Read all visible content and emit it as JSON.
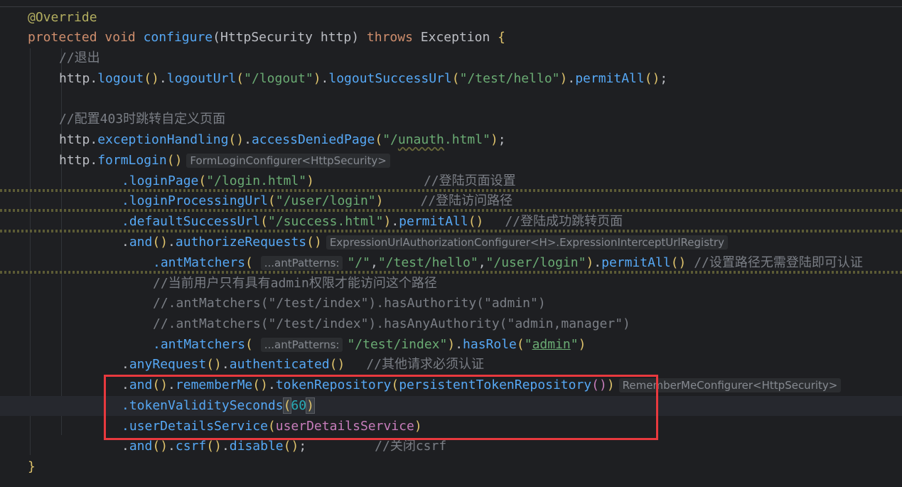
{
  "code_lines": {
    "l1_annotation": "@Override",
    "l2_kw_protected": "protected",
    "l2_kw_void": "void",
    "l2_method": "configure",
    "l2_params": "(HttpSecurity http)",
    "l2_kw_throws": "throws",
    "l2_exception": "Exception",
    "l2_brace": "{",
    "l3_comment": "//退出",
    "l4_http": "http.",
    "l4_logout": "logout",
    "l4_url": "\"/logout\"",
    "l4_success_url": "\"/test/hello\"",
    "l4_logout_url_method": "logoutUrl",
    "l4_logout_success_method": "logoutSuccessUrl",
    "l4_permit": "permitAll",
    "l6_comment": "//配置403时跳转自定义页面",
    "l7_exception": "exceptionHandling",
    "l7_denied": "accessDeniedPage",
    "l7_str_open": "\"/",
    "l7_str_unauth": "unauth",
    "l7_str_close": ".html\"",
    "l8_form": "formLogin",
    "l8_hint": "FormLoginConfigurer<HttpSecurity>",
    "l9_method": ".loginPage",
    "l9_str": "\"/login.html\"",
    "l9_comment": "//登陆页面设置",
    "l10_method": ".loginProcessingUrl",
    "l10_str": "\"/user/login\"",
    "l10_comment": "//登陆访问路径",
    "l11_method": ".defaultSuccessUrl",
    "l11_str": "\"/success.html\"",
    "l11_permit": "permitAll",
    "l11_comment": "//登陆成功跳转页面",
    "l12_and": "and",
    "l12_auth": "authorizeRequests",
    "l12_hint": "ExpressionUrlAuthorizationConfigurer<H>.ExpressionInterceptUrlRegistry",
    "l13_method": ".antMatchers",
    "l13_hint": "...antPatterns:",
    "l13_s1": "\"/\"",
    "l13_s2": "\"/test/hello\"",
    "l13_s3": "\"/user/login\"",
    "l13_permit": "permitAll",
    "l13_comment": "//设置路径无需登陆即可认证",
    "l14_comment": "//当前用户只有具有admin权限才能访问这个路径",
    "l15_comment": "//.antMatchers(\"/test/index\").hasAuthority(\"admin\")",
    "l16_comment": "//.antMatchers(\"/test/index\").hasAnyAuthority(\"admin,manager\")",
    "l17_method": ".antMatchers",
    "l17_hint": "...antPatterns:",
    "l17_str": "\"/test/index\"",
    "l17_role": "hasRole",
    "l17_str_open": "\"",
    "l17_str_admin": "admin",
    "l17_str_close": "\"",
    "l18_any": "anyRequest",
    "l18_authenticated": "authenticated",
    "l18_comment": "//其他请求必须认证",
    "l19_and": "and",
    "l19_remember": "rememberMe",
    "l19_token_repo": "tokenRepository",
    "l19_persist": "persistentTokenRepository",
    "l19_hint": "RememberMeConfigurer<HttpSecurity>",
    "l20_method": ".tokenValiditySeconds",
    "l20_num": "60",
    "l21_method": ".userDetailsService",
    "l21_field": "userDetailsService",
    "l22_and": "and",
    "l22_csrf": "csrf",
    "l22_disable": "disable",
    "l22_comment": "//关闭csrf",
    "l23_brace": "}"
  },
  "colors": {
    "background": "#1e1f22",
    "keyword": "#cf8e6d",
    "method": "#56a8f5",
    "string": "#6aab73",
    "comment": "#7a7e85",
    "number": "#2aacb8",
    "field": "#c77dbb",
    "highlight_box": "#e8393e"
  }
}
